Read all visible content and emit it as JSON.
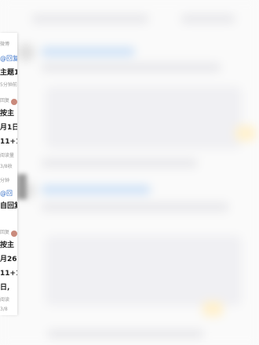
{
  "panel": {
    "lines": [
      {
        "text": "微博",
        "style": "small"
      },
      {
        "text": "@回复",
        "style": "link"
      },
      {
        "text": "主题1,",
        "style": "bold"
      },
      {
        "text": "5分钟前",
        "style": "small"
      },
      {
        "text": "回复",
        "style": "small"
      },
      {
        "text": "按主",
        "style": "bold"
      },
      {
        "text": "月1日",
        "style": "bold"
      },
      {
        "text": "11+1",
        "style": "bold"
      },
      {
        "text": "阅读量",
        "style": "small"
      },
      {
        "text": "3/8收",
        "style": "small"
      },
      {
        "text": "分钟",
        "style": "small"
      },
      {
        "text": "@回",
        "style": "link"
      },
      {
        "text": "自回复",
        "style": "bold"
      },
      {
        "text": "回复",
        "style": "small"
      },
      {
        "text": "按主",
        "style": "bold"
      },
      {
        "text": "月26",
        "style": "bold"
      },
      {
        "text": "11+1",
        "style": "bold"
      },
      {
        "text": "日,",
        "style": "bold"
      },
      {
        "text": "阅读",
        "style": "small"
      },
      {
        "text": "3/8",
        "style": "small"
      }
    ]
  }
}
